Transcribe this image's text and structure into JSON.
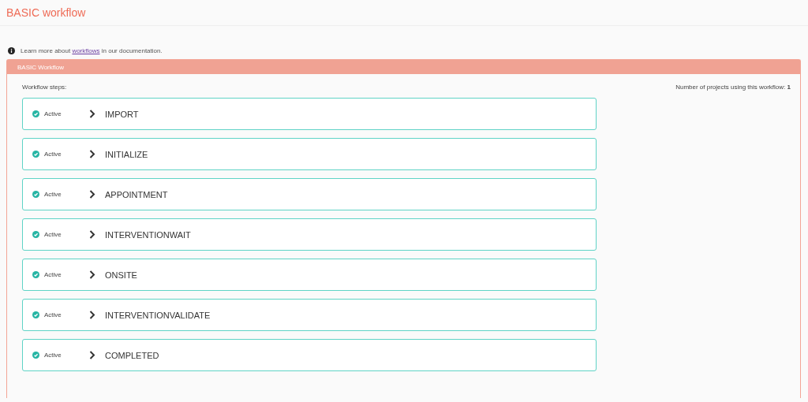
{
  "page_title": "BASIC workflow",
  "info": {
    "text_before": "Learn more about",
    "link": "workflows",
    "text_after": "in our documentation."
  },
  "panel": {
    "title": "BASIC Workflow",
    "steps_label": "Workflow steps:",
    "projects_label": "Number of projects using this workflow:",
    "projects_count": "1",
    "steps": [
      {
        "status": "Active",
        "active": true,
        "name": "IMPORT"
      },
      {
        "status": "Active",
        "active": true,
        "name": "INITIALIZE"
      },
      {
        "status": "Active",
        "active": true,
        "name": "APPOINTMENT"
      },
      {
        "status": "Active",
        "active": true,
        "name": "INTERVENTIONWAIT"
      },
      {
        "status": "Active",
        "active": true,
        "name": "ONSITE"
      },
      {
        "status": "Active",
        "active": true,
        "name": "INTERVENTIONVALIDATE"
      },
      {
        "status": "Active",
        "active": true,
        "name": "COMPLETED"
      }
    ]
  }
}
